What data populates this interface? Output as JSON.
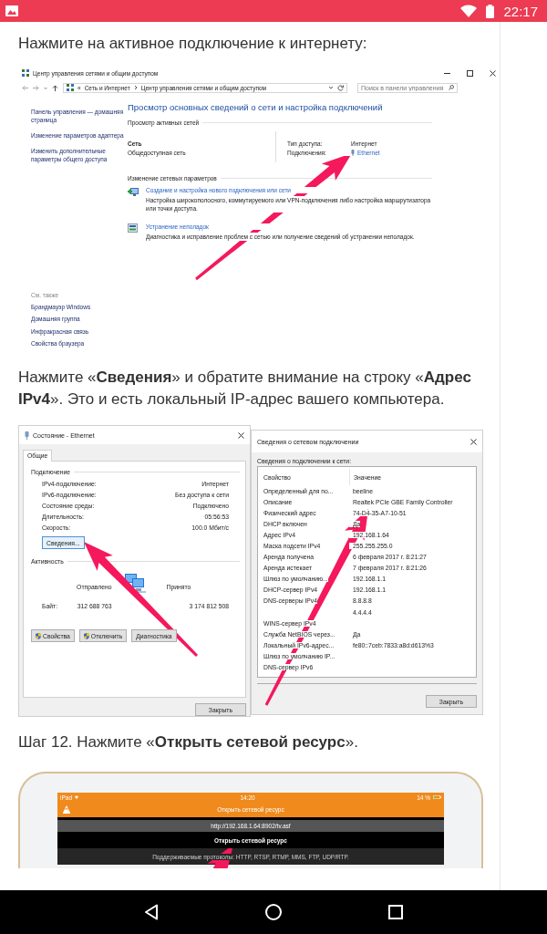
{
  "status_bar": {
    "time": "22:17"
  },
  "intro": "Нажмите на активное подключение к интернету:",
  "network_center": {
    "title": "Центр управления сетями и общим доступом",
    "address": {
      "overflow": "«",
      "crumbs": [
        "Сеть и Интернет",
        "Центр управления сетями и общим доступом"
      ]
    },
    "search": {
      "placeholder": "Поиск в панели управления"
    },
    "sidebar": {
      "links": [
        "Панель управления — домашняя страница",
        "Изменение параметров адаптера",
        "Изменить дополнительные параметры общего доступа"
      ],
      "see_also_title": "См. также",
      "see_also": [
        "Брандмауэр Windows",
        "Домашняя группа",
        "Инфракрасная связь",
        "Свойства браузера"
      ]
    },
    "heading": "Просмотр основных сведений о сети и настройка подключений",
    "active_title": "Просмотр активных сетей",
    "network": {
      "name": "Сеть",
      "type": "Общедоступная сеть",
      "access_label": "Тип доступа:",
      "access_value": "Интернет",
      "connections_label": "Подключения:",
      "connection": "Ethernet"
    },
    "change_title": "Изменение сетевых параметров",
    "actions": [
      {
        "kind": "setup",
        "link": "Создание и настройка нового подключения или сети",
        "description": "Настройка широкополосного, коммутируемого или VPN-подключения либо настройка маршрутизатора или точки доступа."
      },
      {
        "kind": "troubleshoot",
        "link": "Устранение неполадок",
        "description": "Диагностика и исправление проблем с сетью или получение сведений об устранении неполадок."
      }
    ]
  },
  "details_text": "Нажмите «**Сведения**» и обратите внимание на строку «**Адрес IPv4**». Это и есть локальный IP-адрес вашего компьютера.",
  "status_window": {
    "title": "Состояние - Ethernet",
    "tabs": [
      {
        "label": "Общие",
        "selected": true
      }
    ],
    "connection_title": "Подключение",
    "rows": [
      {
        "label": "IPv4-подключение:",
        "value": "Интернет"
      },
      {
        "label": "IPv6-подключение:",
        "value": "Без доступа к сети"
      },
      {
        "label": "Состояние среды:",
        "value": "Подключено"
      },
      {
        "label": "Длительность:",
        "value": "05:56:53"
      },
      {
        "label": "Скорость:",
        "value": "100.0 Мбит/с"
      }
    ],
    "details_button": "Сведения...",
    "activity_title": "Активность",
    "sent_label": "Отправлено",
    "received_label": "Принято",
    "bytes_label": "Байт:",
    "bytes_sent": "312 688 763",
    "bytes_received": "3 174 812 508",
    "buttons": [
      {
        "label": "Свойства",
        "shield": true
      },
      {
        "label": "Отключить",
        "shield": true
      },
      {
        "label": "Диагностика",
        "shield": false
      }
    ],
    "close_button": "Закрыть"
  },
  "details_window": {
    "title": "Сведения о сетевом подключении",
    "caption": "Сведения о подключении к сети:",
    "columns": [
      "Свойство",
      "Значение"
    ],
    "rows": [
      {
        "property": "Определенный для по...",
        "value": "beeline"
      },
      {
        "property": "Описание",
        "value": "Realtek PCIe GBE Family Controller"
      },
      {
        "property": "Физический адрес",
        "value": "74-D4-35-A7-10-51"
      },
      {
        "property": "DHCP включен",
        "value": "Да"
      },
      {
        "property": "Адрес IPv4",
        "value": "192.168.1.64"
      },
      {
        "property": "Маска подсети IPv4",
        "value": "255.255.255.0"
      },
      {
        "property": "Аренда получена",
        "value": "6 февраля 2017 г. 8:21:27"
      },
      {
        "property": "Аренда истекает",
        "value": "7 февраля 2017 г. 8:21:26"
      },
      {
        "property": "Шлюз по умолчанию...",
        "value": "192.168.1.1"
      },
      {
        "property": "DHCP-сервер IPv4",
        "value": "192.168.1.1"
      },
      {
        "property": "DNS-серверы IPv4",
        "value": "8.8.8.8"
      },
      {
        "value": "4.4.4.4"
      },
      {
        "property": "WINS-сервер IPv4"
      },
      {
        "property": "Служба NetBIOS через...",
        "value": "Да"
      },
      {
        "property": "Локальный IPv6-адрес...",
        "value": "fe80::7ceb:7833:a8d:d613%3"
      },
      {
        "property": "Шлюз по умолчанию IP..."
      },
      {
        "property": "DNS-сервер IPv6"
      }
    ],
    "close_button": "Закрыть"
  },
  "step_text": "Шаг 12. Нажмите «**Открыть сетевой ресурс**».",
  "tablet": {
    "device": "iPad",
    "time": "14:20",
    "battery": "14 %",
    "title": "Открыть сетевой ресурс",
    "url": "http://192.168.1.64:8902/tv.asf",
    "open_button": "Открыть сетевой ресурс",
    "protocols": "Поддерживаемые протоколы: HTTP, RTSP, RTMP, MMS, FTP, UDP/RTP."
  }
}
